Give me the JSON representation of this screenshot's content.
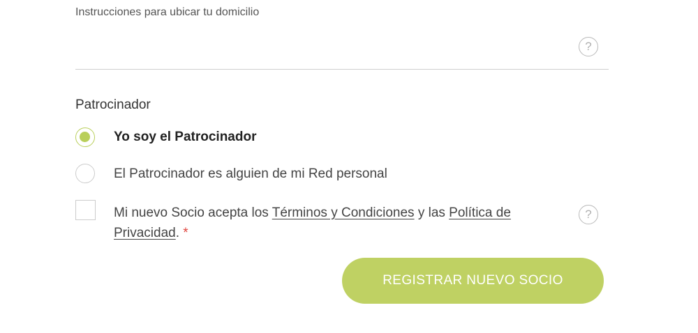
{
  "address_instructions": {
    "label": "Instrucciones para ubicar tu domicilio",
    "value": "",
    "help_icon": "?"
  },
  "sponsor": {
    "title": "Patrocinador",
    "options": [
      {
        "label": "Yo soy el Patrocinador",
        "checked": true
      },
      {
        "label": "El Patrocinador es alguien de mi Red personal",
        "checked": false
      }
    ]
  },
  "terms": {
    "checked": false,
    "text_before": "Mi nuevo Socio acepta los ",
    "link_terms": "Términos y Condiciones",
    "text_middle": " y las ",
    "link_privacy": "Política de Privacidad",
    "text_after": ".",
    "required_mark": "*",
    "help_icon": "?"
  },
  "submit_label": "REGISTRAR NUEVO SOCIO",
  "colors": {
    "accent": "#bfd163",
    "radio_accent": "#b9cf5a",
    "required": "#e0443e"
  }
}
